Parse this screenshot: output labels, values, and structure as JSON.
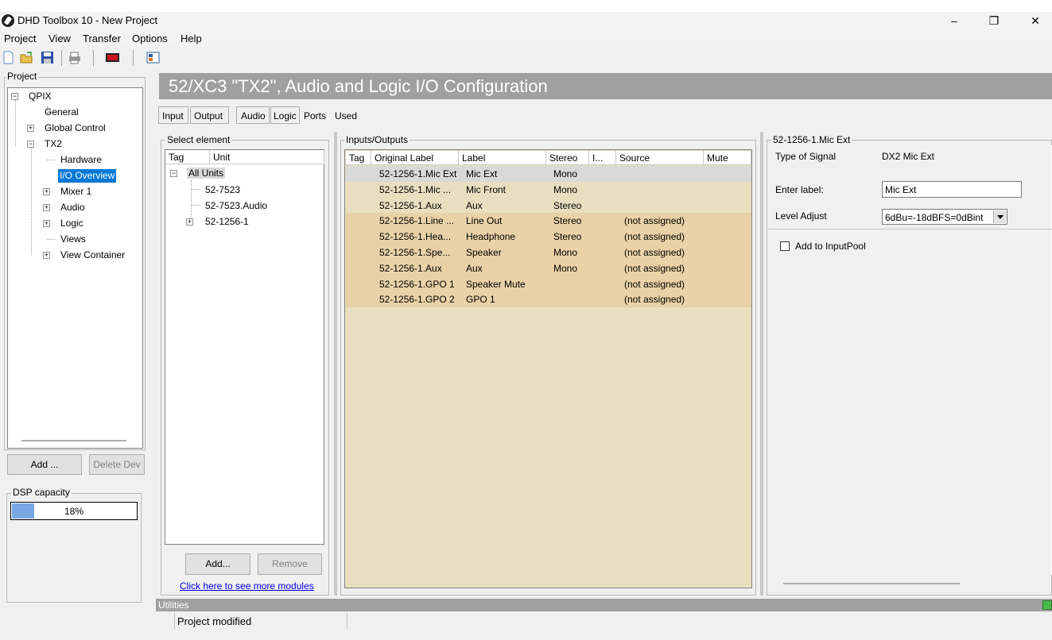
{
  "window": {
    "title": "DHD Toolbox 10 - New Project"
  },
  "menu": [
    "Project",
    "View",
    "Transfer",
    "Options",
    "Help"
  ],
  "project_panel": {
    "label": "Project",
    "tree": {
      "root": "QPIX",
      "general": "General",
      "global_control": "Global Control",
      "tx2": "TX2",
      "hardware": "Hardware",
      "io_overview": "I/O Overview",
      "mixer": "Mixer 1",
      "audio": "Audio",
      "logic": "Logic",
      "views": "Views",
      "view_container": "View Container"
    },
    "add_button": "Add ...",
    "delete_button": "Delete Dev",
    "dsp_label": "DSP capacity",
    "dsp_value": "18%",
    "dsp_fraction": 0.18
  },
  "header": {
    "title": "52/XC3 \"TX2\", Audio and Logic I/O  Configuration"
  },
  "tabs": {
    "input": "Input",
    "output": "Output",
    "audio": "Audio",
    "logic": "Logic",
    "ports": "Ports",
    "used": "Used"
  },
  "select_element": {
    "label": "Select element",
    "col_tag": "Tag",
    "col_unit": "Unit",
    "items": {
      "all_units": "All Units",
      "u1": "52-7523",
      "u2": "52-7523.Audio",
      "u3": "52-1256-1"
    },
    "add_button": "Add...",
    "remove_button": "Remove",
    "more_modules_link": "Click here to see more modules"
  },
  "io": {
    "label": "Inputs/Outputs",
    "columns": [
      "Tag",
      "Original Label",
      "Label",
      "Stereo",
      "I...",
      "Source",
      "Mute"
    ],
    "rows": [
      {
        "original": "52-1256-1.Mic Ext",
        "label": "Mic Ext",
        "stereo": "Mono",
        "source": ""
      },
      {
        "original": "52-1256-1.Mic ...",
        "label": "Mic Front",
        "stereo": "Mono",
        "source": ""
      },
      {
        "original": "52-1256-1.Aux",
        "label": "Aux",
        "stereo": "Stereo",
        "source": ""
      },
      {
        "original": "52-1256-1.Line ...",
        "label": "Line Out",
        "stereo": "Stereo",
        "source": "(not assigned)"
      },
      {
        "original": "52-1256-1.Hea...",
        "label": "Headphone",
        "stereo": "Stereo",
        "source": "(not assigned)"
      },
      {
        "original": "52-1256-1.Spe...",
        "label": "Speaker",
        "stereo": "Mono",
        "source": "(not assigned)"
      },
      {
        "original": "52-1256-1.Aux",
        "label": "Aux",
        "stereo": "Mono",
        "source": "(not assigned)"
      },
      {
        "original": "52-1256-1.GPO 1",
        "label": "Speaker Mute",
        "stereo": "",
        "source": "(not assigned)"
      },
      {
        "original": "52-1256-1.GPO 2",
        "label": "GPO 1",
        "stereo": "",
        "source": "(not assigned)"
      }
    ]
  },
  "details": {
    "label": "52-1256-1.Mic Ext",
    "type_label": "Type of Signal",
    "type_value": "DX2 Mic Ext",
    "enter_label": "Enter label:",
    "label_value": "Mic Ext",
    "level_label": "Level Adjust",
    "level_value": "6dBu=-18dBFS=0dBint",
    "inputpool_label": "Add to InputPool"
  },
  "utilities": {
    "label": "Utilities"
  },
  "status": {
    "text": "Project modified"
  }
}
